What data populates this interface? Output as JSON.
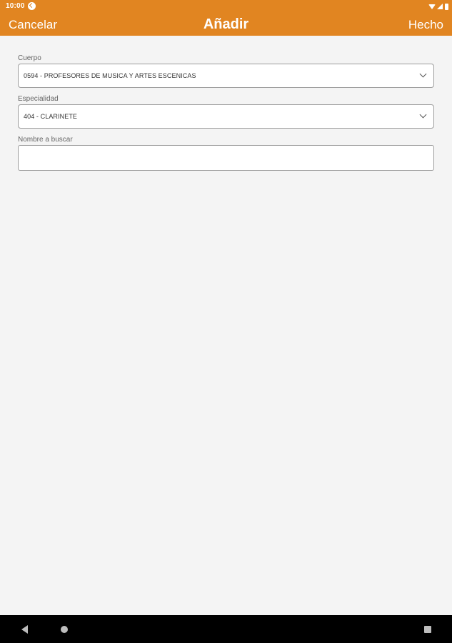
{
  "status_bar": {
    "time": "10:00",
    "icons": [
      "notification-icon",
      "wifi-icon",
      "signal-icon",
      "battery-icon"
    ]
  },
  "app_bar": {
    "cancel_label": "Cancelar",
    "title": "Añadir",
    "done_label": "Hecho",
    "color": "#e18521"
  },
  "form": {
    "cuerpo": {
      "label": "Cuerpo",
      "value": "0594 - PROFESORES DE MUSICA Y ARTES ESCENICAS"
    },
    "especialidad": {
      "label": "Especialidad",
      "value": "404 - CLARINETE"
    },
    "nombre": {
      "label": "Nombre a buscar",
      "value": ""
    }
  },
  "nav_bar": {
    "icons": [
      "back-icon",
      "home-icon",
      "recents-icon"
    ]
  }
}
